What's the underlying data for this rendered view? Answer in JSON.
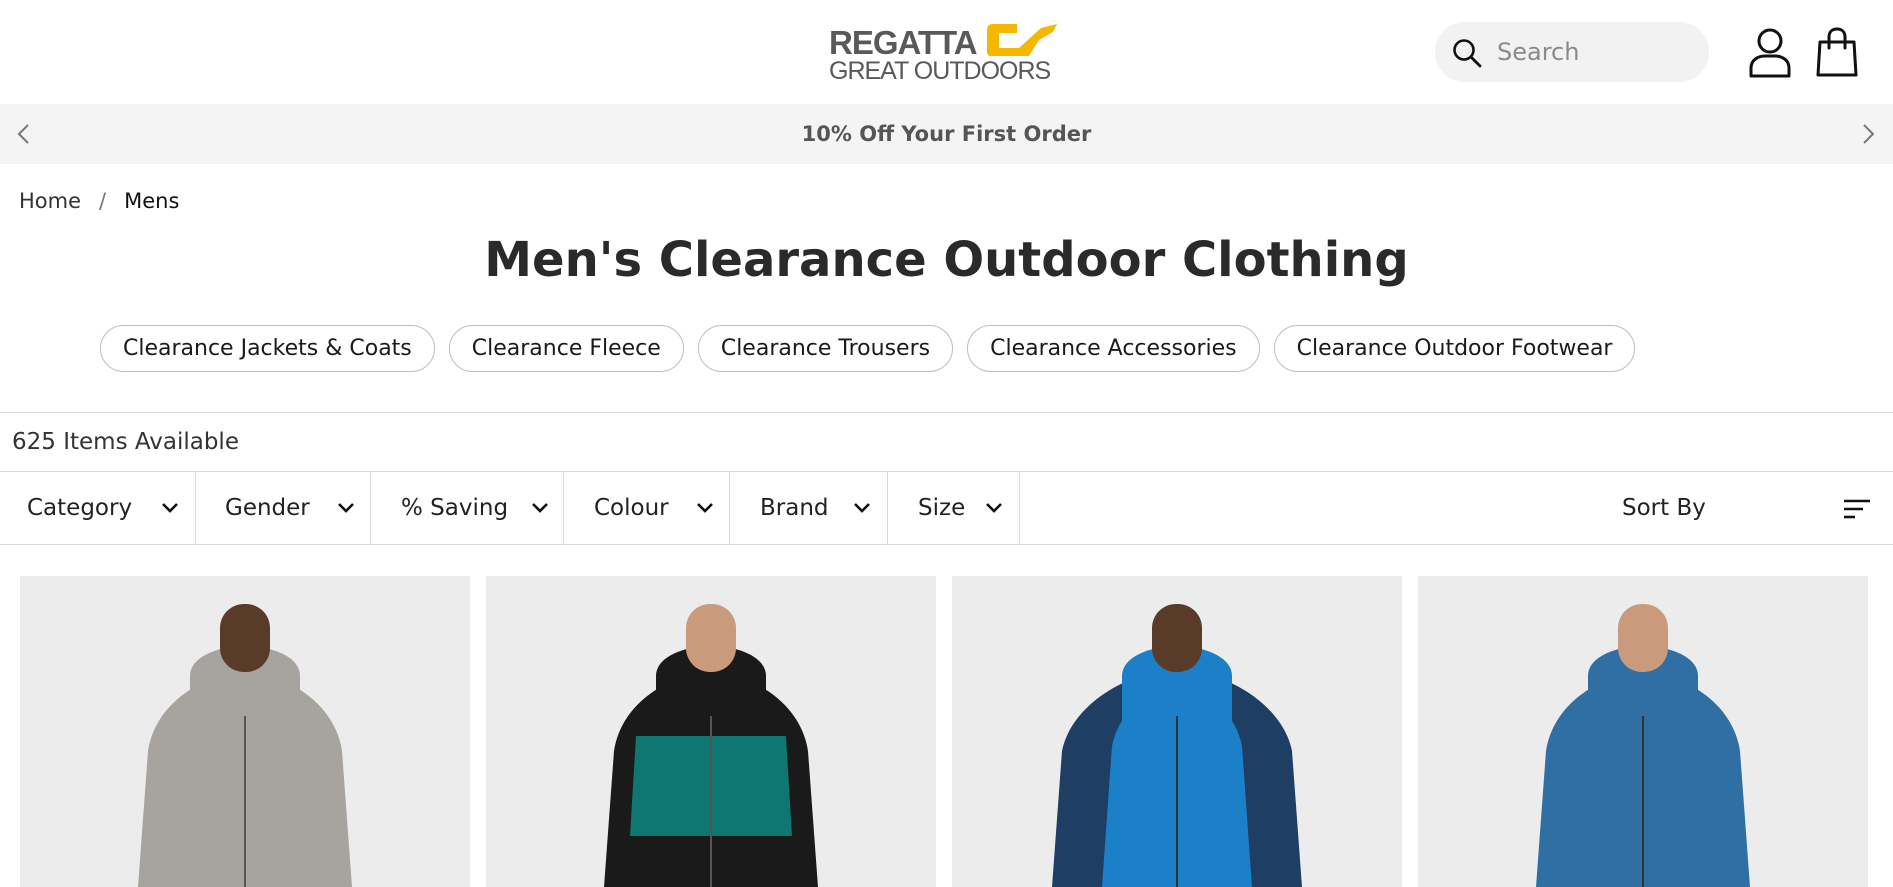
{
  "header": {
    "logo": {
      "line1": "REGATTA",
      "line2": "GREAT OUTDOORS",
      "accent_color": "#f5b700"
    },
    "search": {
      "placeholder": "Search",
      "icon": "search-icon"
    },
    "account_icon": "user-icon",
    "bag_icon": "shopping-bag-icon"
  },
  "promo": {
    "text": "10% Off Your First Order"
  },
  "breadcrumb": {
    "items": [
      "Home",
      "Mens"
    ],
    "separator": "/"
  },
  "page": {
    "title": "Men's Clearance Outdoor Clothing"
  },
  "categories": [
    "Clearance Jackets & Coats",
    "Clearance Fleece",
    "Clearance Trousers",
    "Clearance Accessories",
    "Clearance Outdoor Footwear"
  ],
  "results": {
    "count_text": "625 Items Available"
  },
  "filters": {
    "items": [
      "Category",
      "Gender",
      "% Saving",
      "Colour",
      "Brand",
      "Size"
    ],
    "sort_label": "Sort By"
  },
  "products": [
    {
      "jacket_color": "#a7a4a0",
      "accent_color": "#a7a4a0",
      "skin": "#5a3a28"
    },
    {
      "jacket_color": "#1a1a1a",
      "accent_color": "#0f7772",
      "skin": "#c99a7c"
    },
    {
      "jacket_color": "#1c80c8",
      "accent_color": "#1e3e64",
      "skin": "#5a3a28"
    },
    {
      "jacket_color": "#2f6fa4",
      "accent_color": "#2f6fa4",
      "skin": "#c99a7c"
    }
  ]
}
